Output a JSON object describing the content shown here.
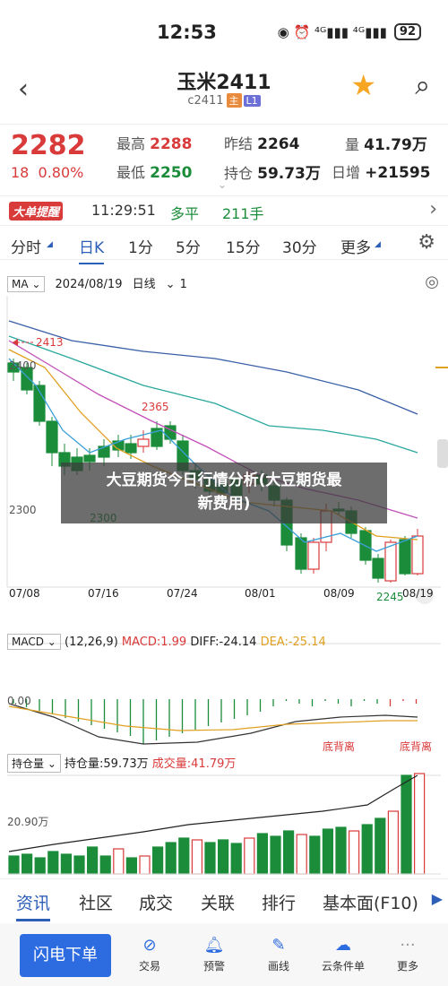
{
  "status": {
    "time": "12:53",
    "icons": "◉ ⏰ ⁴ᴳ▮▮▮ ⁴ᴳ▮▮▮",
    "battery": "92"
  },
  "header": {
    "title": "玉米2411",
    "code": "c2411",
    "tag1": "主",
    "tag2": "L1"
  },
  "quote": {
    "price": "2282",
    "change": "18",
    "pct": "0.80%",
    "high_label": "最高",
    "high": "2288",
    "low_label": "最低",
    "low": "2250",
    "prev_label": "昨结",
    "prev": "2264",
    "oi_label": "持仓",
    "oi": "59.73万",
    "vol_label": "量",
    "vol": "41.79万",
    "inc_label": "日增",
    "inc": "+21595"
  },
  "ticker": {
    "badge": "大单提醒",
    "time": "11:29:51",
    "type": "多平",
    "qty": "211手"
  },
  "tabs": [
    "分时",
    "日K",
    "1分",
    "5分",
    "15分",
    "30分",
    "更多"
  ],
  "chart_toolbar": {
    "ma": "MA",
    "date": "2024/08/19",
    "period": "日线",
    "num": "1"
  },
  "kline": {
    "labels": {
      "high_mark": "2413",
      "y_top": "2400",
      "y_mid": "2300",
      "peak": "2365",
      "low1": "2300",
      "low2": "2245"
    },
    "dates": [
      "07/08",
      "07/16",
      "07/24",
      "08/01",
      "08/09",
      "08/19"
    ]
  },
  "macd": {
    "sel": "MACD",
    "params": "(12,26,9)",
    "macd": "MACD:1.99",
    "diff": "DIFF:-24.14",
    "dea": "DEA:-25.14",
    "zero": "0.00",
    "div1": "底背离",
    "div2": "底背离"
  },
  "oi_panel": {
    "sel": "持仓量",
    "oi": "持仓量:59.73万",
    "vol": "成交量:41.79万",
    "y": "20.90万"
  },
  "banner": {
    "line1": "大豆期货今日行情分析(大豆期货最",
    "line2": "新费用)"
  },
  "bottom_tabs": [
    "资讯",
    "社区",
    "成交",
    "关联",
    "排行",
    "基本面(F10)"
  ],
  "footer": {
    "flash": "闪电下单",
    "items": [
      "交易",
      "预警",
      "画线",
      "云条件单",
      "更多"
    ]
  },
  "colors": {
    "up": "#d93a3a",
    "down": "#1b8c3a",
    "accent": "#2d5fb8"
  }
}
